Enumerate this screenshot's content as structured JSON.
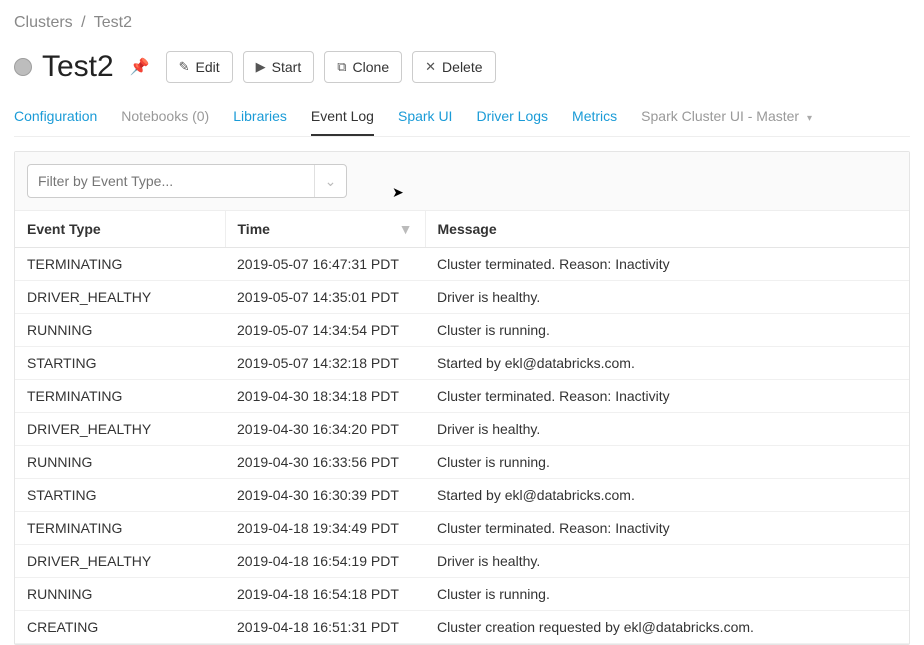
{
  "breadcrumb": {
    "parent": "Clusters",
    "current": "Test2"
  },
  "header": {
    "cluster_name": "Test2",
    "buttons": {
      "edit": "Edit",
      "start": "Start",
      "clone": "Clone",
      "delete": "Delete"
    }
  },
  "tabs": {
    "configuration": "Configuration",
    "notebooks": "Notebooks (0)",
    "libraries": "Libraries",
    "event_log": "Event Log",
    "spark_ui": "Spark UI",
    "driver_logs": "Driver Logs",
    "metrics": "Metrics",
    "spark_cluster_ui": "Spark Cluster UI - Master"
  },
  "filter": {
    "placeholder": "Filter by Event Type..."
  },
  "columns": {
    "event_type": "Event Type",
    "time": "Time",
    "message": "Message"
  },
  "events": [
    {
      "type": "TERMINATING",
      "time": "2019-05-07 16:47:31 PDT",
      "message": "Cluster terminated. Reason: Inactivity"
    },
    {
      "type": "DRIVER_HEALTHY",
      "time": "2019-05-07 14:35:01 PDT",
      "message": "Driver is healthy."
    },
    {
      "type": "RUNNING",
      "time": "2019-05-07 14:34:54 PDT",
      "message": "Cluster is running."
    },
    {
      "type": "STARTING",
      "time": "2019-05-07 14:32:18 PDT",
      "message": "Started by ekl@databricks.com."
    },
    {
      "type": "TERMINATING",
      "time": "2019-04-30 18:34:18 PDT",
      "message": "Cluster terminated. Reason: Inactivity"
    },
    {
      "type": "DRIVER_HEALTHY",
      "time": "2019-04-30 16:34:20 PDT",
      "message": "Driver is healthy."
    },
    {
      "type": "RUNNING",
      "time": "2019-04-30 16:33:56 PDT",
      "message": "Cluster is running."
    },
    {
      "type": "STARTING",
      "time": "2019-04-30 16:30:39 PDT",
      "message": "Started by ekl@databricks.com."
    },
    {
      "type": "TERMINATING",
      "time": "2019-04-18 19:34:49 PDT",
      "message": "Cluster terminated. Reason: Inactivity"
    },
    {
      "type": "DRIVER_HEALTHY",
      "time": "2019-04-18 16:54:19 PDT",
      "message": "Driver is healthy."
    },
    {
      "type": "RUNNING",
      "time": "2019-04-18 16:54:18 PDT",
      "message": "Cluster is running."
    },
    {
      "type": "CREATING",
      "time": "2019-04-18 16:51:31 PDT",
      "message": "Cluster creation requested by ekl@databricks.com."
    }
  ]
}
